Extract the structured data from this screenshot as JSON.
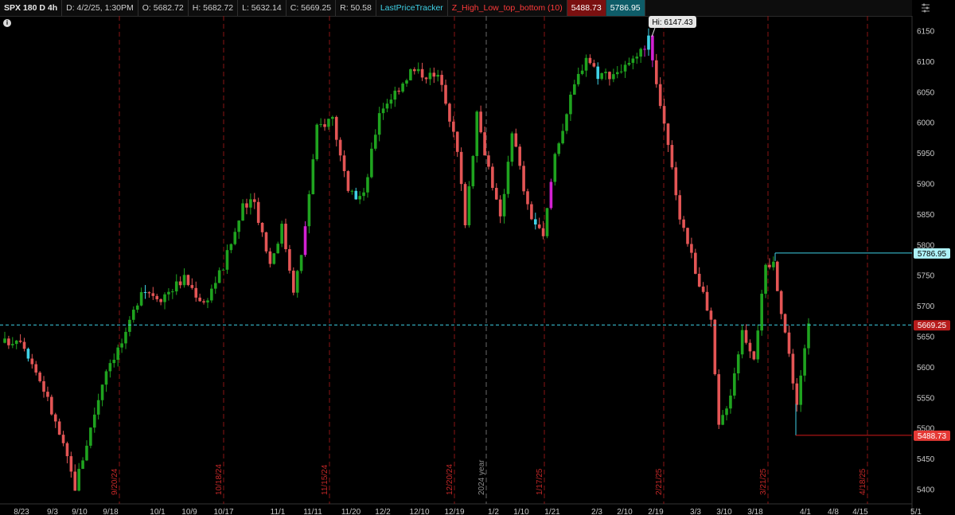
{
  "header": {
    "symbol": "SPX 180 D 4h",
    "date": "D: 4/2/25, 1:30PM",
    "open": "O: 5682.72",
    "high": "H: 5682.72",
    "low": "L: 5632.14",
    "close": "C: 5669.25",
    "range": "R: 50.58",
    "study1": "LastPriceTracker",
    "study2": "Z_High_Low_top_bottom (10)",
    "study2_val1": "5488.73",
    "study2_val2": "5786.95"
  },
  "info_icon": "i",
  "icons": {
    "settings": "sliders-icon",
    "info": "info-icon"
  },
  "colors": {
    "up": "#1fa31f",
    "down": "#e35555",
    "hi": "#d321d3",
    "lo": "#3fd1e6",
    "accent_cyan": "#3fd1e6",
    "accent_red": "#d01818"
  },
  "chart_data": {
    "type": "candlestick",
    "ylim": [
      5380,
      6170
    ],
    "y_ticks": [
      "6150",
      "6100",
      "6050",
      "6000",
      "5950",
      "5900",
      "5850",
      "5800",
      "5750",
      "5700",
      "5650",
      "5600",
      "5550",
      "5500",
      "5450",
      "5400"
    ],
    "x_ticks": [
      "8/23",
      "9/3",
      "9/10",
      "9/18",
      "10/1",
      "10/9",
      "10/17",
      "11/1",
      "11/11",
      "11/20",
      "12/2",
      "12/10",
      "12/19",
      "1/2",
      "1/10",
      "1/21",
      "2/3",
      "2/10",
      "2/19",
      "3/3",
      "3/10",
      "3/18",
      "4/1",
      "4/8",
      "4/15",
      "5/1"
    ],
    "vertical_markers": [
      "9/20/24",
      "10/18/24",
      "11/15/24",
      "12/20/24",
      "2024 year",
      "1/17/25",
      "2/21/25",
      "3/21/25",
      "4/18/25"
    ],
    "high_label": "Hi: 6147.43",
    "last_price": "5669.25",
    "zhigh_label": "5786.95",
    "zlow_label": "5488.73",
    "anchors": [
      [
        0,
        5640
      ],
      [
        4,
        5650
      ],
      [
        10,
        5565
      ],
      [
        15,
        5470
      ],
      [
        18,
        5405
      ],
      [
        22,
        5500
      ],
      [
        26,
        5600
      ],
      [
        31,
        5650
      ],
      [
        35,
        5730
      ],
      [
        40,
        5715
      ],
      [
        46,
        5745
      ],
      [
        51,
        5705
      ],
      [
        56,
        5765
      ],
      [
        61,
        5860
      ],
      [
        64,
        5870
      ],
      [
        68,
        5770
      ],
      [
        71,
        5830
      ],
      [
        74,
        5730
      ],
      [
        76,
        5780
      ],
      [
        80,
        5990
      ],
      [
        84,
        6010
      ],
      [
        88,
        5880
      ],
      [
        92,
        5880
      ],
      [
        96,
        6020
      ],
      [
        100,
        6050
      ],
      [
        104,
        6085
      ],
      [
        108,
        6080
      ],
      [
        112,
        6070
      ],
      [
        116,
        5950
      ],
      [
        118,
        5840
      ],
      [
        121,
        6010
      ],
      [
        125,
        5900
      ],
      [
        127,
        5840
      ],
      [
        130,
        5990
      ],
      [
        134,
        5860
      ],
      [
        138,
        5810
      ],
      [
        141,
        5950
      ],
      [
        146,
        6060
      ],
      [
        149,
        6110
      ],
      [
        152,
        6080
      ],
      [
        155,
        6080
      ],
      [
        159,
        6090
      ],
      [
        162,
        6100
      ],
      [
        165,
        6140
      ],
      [
        167,
        6060
      ],
      [
        170,
        5960
      ],
      [
        173,
        5850
      ],
      [
        177,
        5760
      ],
      [
        181,
        5670
      ],
      [
        183,
        5500
      ],
      [
        186,
        5560
      ],
      [
        189,
        5660
      ],
      [
        192,
        5620
      ],
      [
        195,
        5760
      ],
      [
        197,
        5770
      ],
      [
        201,
        5620
      ],
      [
        203,
        5540
      ],
      [
        206,
        5670
      ]
    ],
    "n_bars": 207
  }
}
